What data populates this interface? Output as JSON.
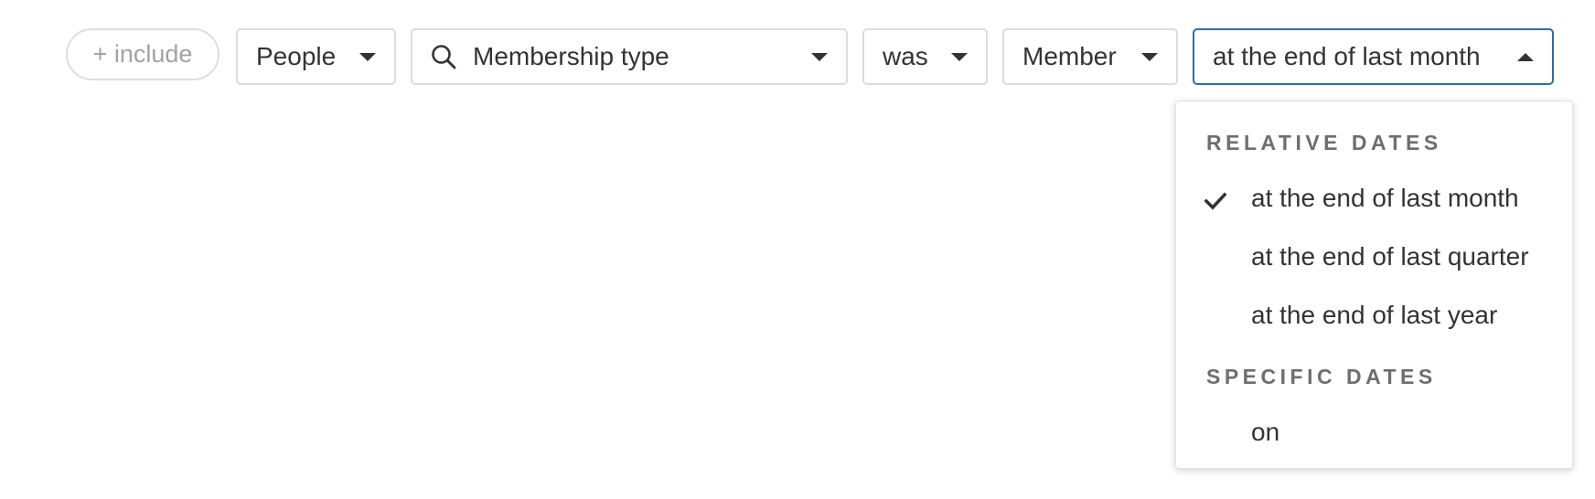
{
  "filter_bar": {
    "include_label": "+ include",
    "subject": {
      "label": "People"
    },
    "field": {
      "label": "Membership type",
      "icon": "search-icon"
    },
    "operator": {
      "label": "was"
    },
    "value": {
      "label": "Member"
    },
    "time": {
      "label": "at the end of last month"
    }
  },
  "time_dropdown": {
    "relative_heading": "RELATIVE DATES",
    "relative_options": [
      {
        "label": "at the end of last month",
        "selected": true
      },
      {
        "label": "at the end of last quarter",
        "selected": false
      },
      {
        "label": "at the end of last year",
        "selected": false
      }
    ],
    "specific_heading": "SPECIFIC DATES",
    "specific_options": [
      {
        "label": "on",
        "selected": false
      }
    ]
  },
  "colors": {
    "active_border": "#2a6fa6",
    "text": "#333333",
    "muted": "#a2a2a2",
    "heading": "#6e6e6e"
  }
}
